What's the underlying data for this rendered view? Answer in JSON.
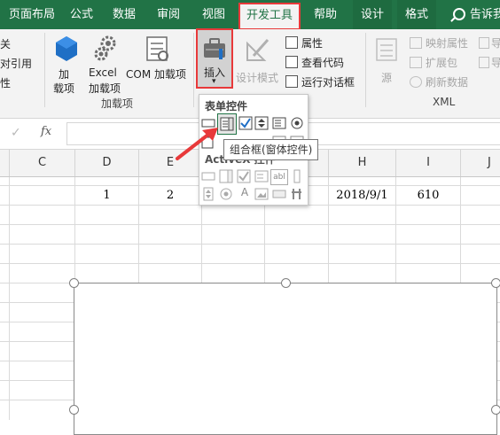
{
  "ribbon_tabs": [
    {
      "label": "页面布局"
    },
    {
      "label": "公式"
    },
    {
      "label": "数据"
    },
    {
      "label": "审阅"
    },
    {
      "label": "视图"
    },
    {
      "label": "开发工具"
    },
    {
      "label": "帮助"
    },
    {
      "label": "设计"
    },
    {
      "label": "格式"
    }
  ],
  "tell_me": "告诉我",
  "code_group": {
    "item1": "关",
    "item2": "对引用",
    "item3": "性"
  },
  "addins": {
    "addins_label1": "加",
    "addins_label2": "载项",
    "excel_label1": "Excel",
    "excel_label2": "加载项",
    "com_label": "COM 加载项",
    "group_label": "加载项"
  },
  "controls": {
    "insert_label": "插入",
    "design_mode": "设计模式",
    "properties": "属性",
    "view_code": "查看代码",
    "run_dialog": "运行对话框"
  },
  "xml": {
    "source": "源",
    "map_properties": "映射属性",
    "expansion_pack": "扩展包",
    "refresh_data": "刷新数据",
    "import_short": "导",
    "export_short": "导",
    "group_label": "XML"
  },
  "formula_bar": {
    "fx": "fx",
    "check": "✓"
  },
  "column_headers": [
    "C",
    "D",
    "E",
    "H",
    "I",
    "J"
  ],
  "cells": {
    "d_value": "1",
    "e_value": "2",
    "h_value": "2018/9/1",
    "i_value": "610"
  },
  "dropdown": {
    "form_controls_title": "表单控件",
    "activex_title": "ActiveX 控件",
    "tooltip": "组合框(窗体控件)",
    "label_glyph": "A",
    "textbox_glyph": "abl"
  },
  "colors": {
    "ribbon_green": "#217346",
    "highlight_red": "#e8393a"
  }
}
